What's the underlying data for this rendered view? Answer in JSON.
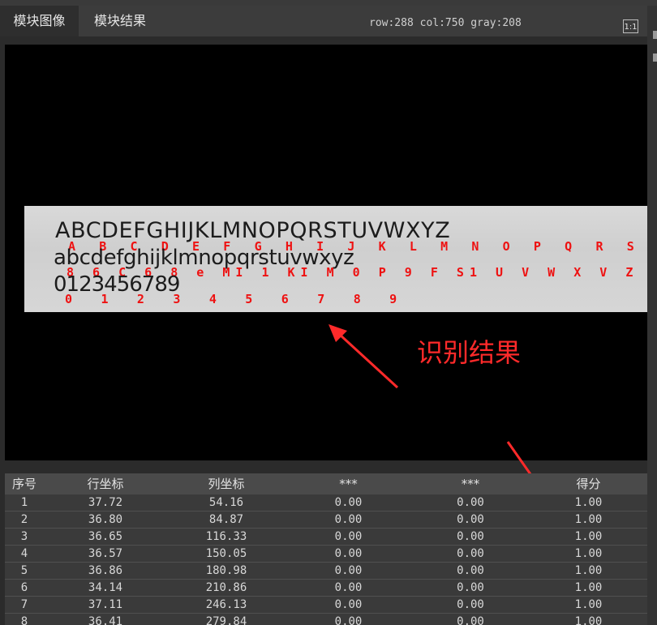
{
  "tabs": [
    {
      "label": "模块图像"
    },
    {
      "label": "模块结果"
    }
  ],
  "status_text": "row:288 col:750 gray:208",
  "zoom_button_label": "1:1",
  "image": {
    "printed_lines": [
      "ABCDEFGHIJKLMNOPQRSTUVWXYZ",
      "abcdefghijklmnopqrstuvwxyz",
      "0123456789"
    ],
    "recognized_lines": [
      "A B C D E F G H I J K L M N O P Q R S T U V  W X Y Z",
      "8 6 C 6 8  e MI 1 KI M   0 P 9 F S1 U V W X V Z",
      "0 1 2 3 4 5 6 7 8 9"
    ],
    "annotation": "识别结果",
    "annotation_color": "#ff2a2a"
  },
  "table": {
    "columns": [
      "序号",
      "行坐标",
      "列坐标",
      "***",
      "***",
      "得分"
    ],
    "rows": [
      [
        "1",
        "37.72",
        "54.16",
        "0.00",
        "0.00",
        "1.00"
      ],
      [
        "2",
        "36.80",
        "84.87",
        "0.00",
        "0.00",
        "1.00"
      ],
      [
        "3",
        "36.65",
        "116.33",
        "0.00",
        "0.00",
        "1.00"
      ],
      [
        "4",
        "36.57",
        "150.05",
        "0.00",
        "0.00",
        "1.00"
      ],
      [
        "5",
        "36.86",
        "180.98",
        "0.00",
        "0.00",
        "1.00"
      ],
      [
        "6",
        "34.14",
        "210.86",
        "0.00",
        "0.00",
        "1.00"
      ],
      [
        "7",
        "37.11",
        "246.13",
        "0.00",
        "0.00",
        "1.00"
      ],
      [
        "8",
        "36.41",
        "279.84",
        "0.00",
        "0.00",
        "1.00"
      ]
    ]
  }
}
